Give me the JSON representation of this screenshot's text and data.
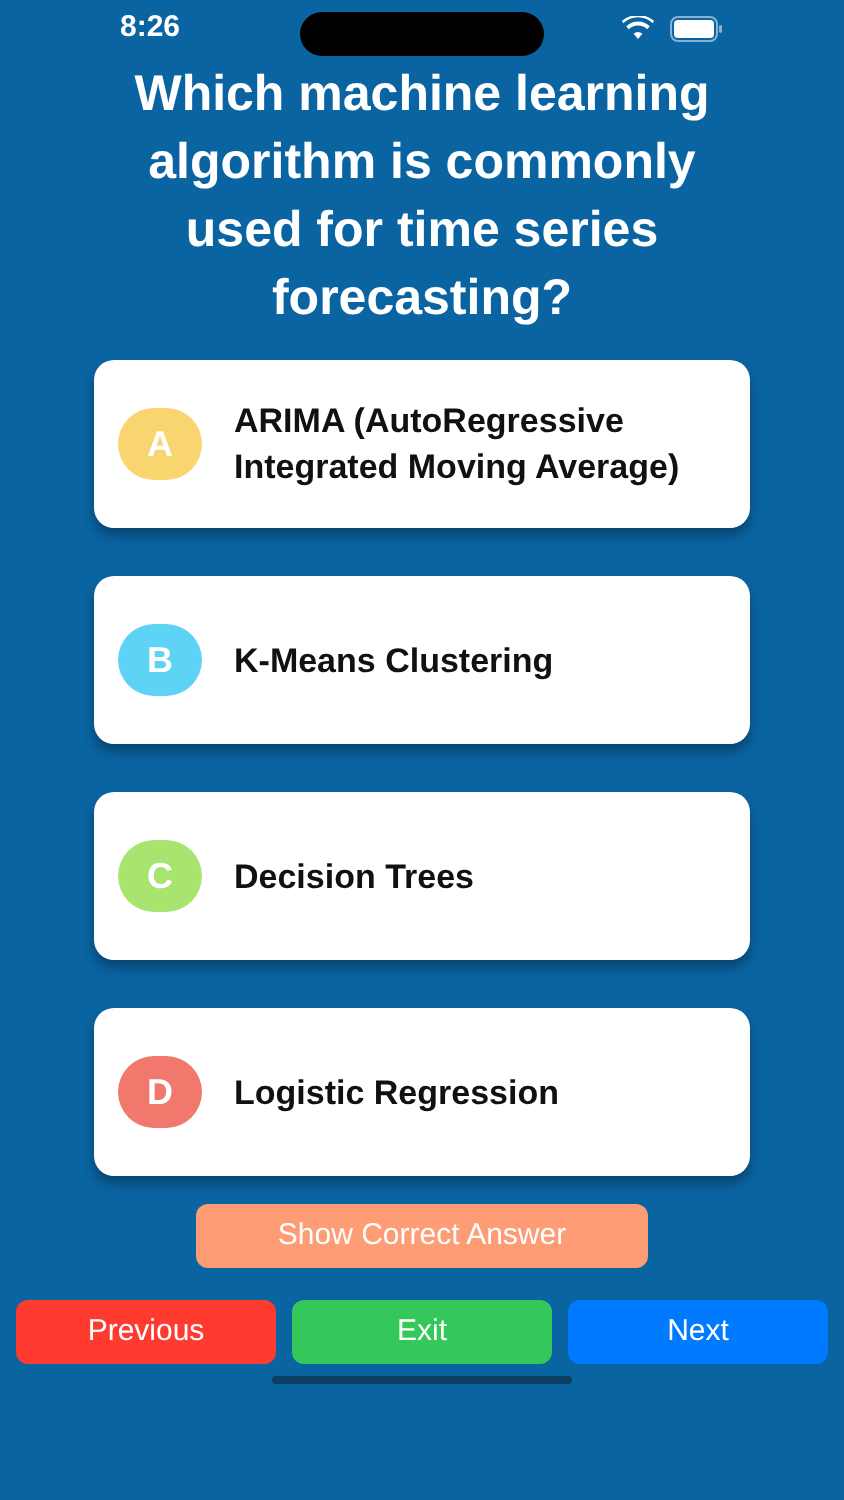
{
  "status_bar": {
    "time": "8:26"
  },
  "question": "Which machine learning algorithm is commonly used for time series forecasting?",
  "options": [
    {
      "letter": "A",
      "text": "ARIMA (AutoRegressive Integrated Moving Average)",
      "color": "#f8d56f"
    },
    {
      "letter": "B",
      "text": "K-Means Clustering",
      "color": "#5fd3f5"
    },
    {
      "letter": "C",
      "text": "Decision Trees",
      "color": "#a7e56f"
    },
    {
      "letter": "D",
      "text": "Logistic Regression",
      "color": "#f0786c"
    }
  ],
  "show_answer_button": "Show Correct Answer",
  "nav_buttons": [
    {
      "kind": "previous",
      "label": "Previous"
    },
    {
      "kind": "exit",
      "label": "Exit"
    },
    {
      "kind": "next",
      "label": "Next"
    }
  ]
}
